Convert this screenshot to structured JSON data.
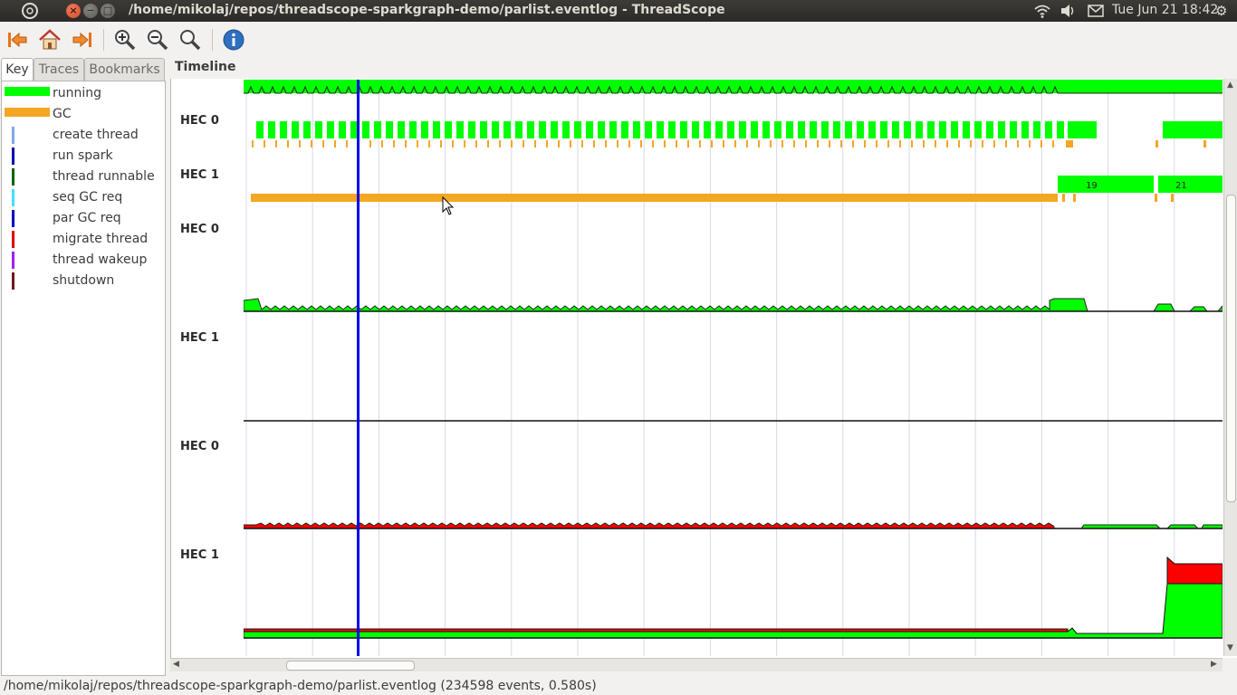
{
  "window": {
    "title": "/home/mikolaj/repos/threadscope-sparkgraph-demo/parlist.eventlog - ThreadScope",
    "clock": "Tue Jun 21 18:42"
  },
  "toolbar": {
    "buttons": [
      "first-icon",
      "home-icon",
      "last-icon",
      "zoom-in-icon",
      "zoom-out-icon",
      "zoom-fit-icon",
      "info-icon"
    ]
  },
  "sidebar": {
    "tabs": [
      {
        "label": "Key",
        "active": true
      },
      {
        "label": "Traces",
        "active": false
      },
      {
        "label": "Bookmarks",
        "active": false
      }
    ],
    "key_items": [
      {
        "label": "running",
        "color": "#00ff00",
        "kind": "bar"
      },
      {
        "label": "GC",
        "color": "#f5a623",
        "kind": "bar"
      },
      {
        "label": "create thread",
        "color": "#7fa8e8",
        "kind": "line"
      },
      {
        "label": "run spark",
        "color": "#0000b0",
        "kind": "line"
      },
      {
        "label": "thread runnable",
        "color": "#006400",
        "kind": "line"
      },
      {
        "label": "seq GC req",
        "color": "#40e0ff",
        "kind": "line"
      },
      {
        "label": "par GC req",
        "color": "#0000c8",
        "kind": "line"
      },
      {
        "label": "migrate thread",
        "color": "#e00000",
        "kind": "line"
      },
      {
        "label": "thread wakeup",
        "color": "#a020f0",
        "kind": "line"
      },
      {
        "label": "shutdown",
        "color": "#6b1a1a",
        "kind": "line"
      }
    ]
  },
  "timeline": {
    "title": "Timeline",
    "hec_labels": [
      "HEC 0",
      "HEC 1",
      "HEC 0",
      "HEC 1",
      "HEC 0",
      "HEC 1"
    ],
    "bar_labels": [
      "19",
      "21"
    ],
    "colors": {
      "running": "#00ff00",
      "gc": "#f5a623",
      "cursor": "#0000ee",
      "spark": "#ff0000"
    }
  },
  "status": {
    "text": "/home/mikolaj/repos/threadscope-sparkgraph-demo/parlist.eventlog (234598 events, 0.580s)"
  }
}
